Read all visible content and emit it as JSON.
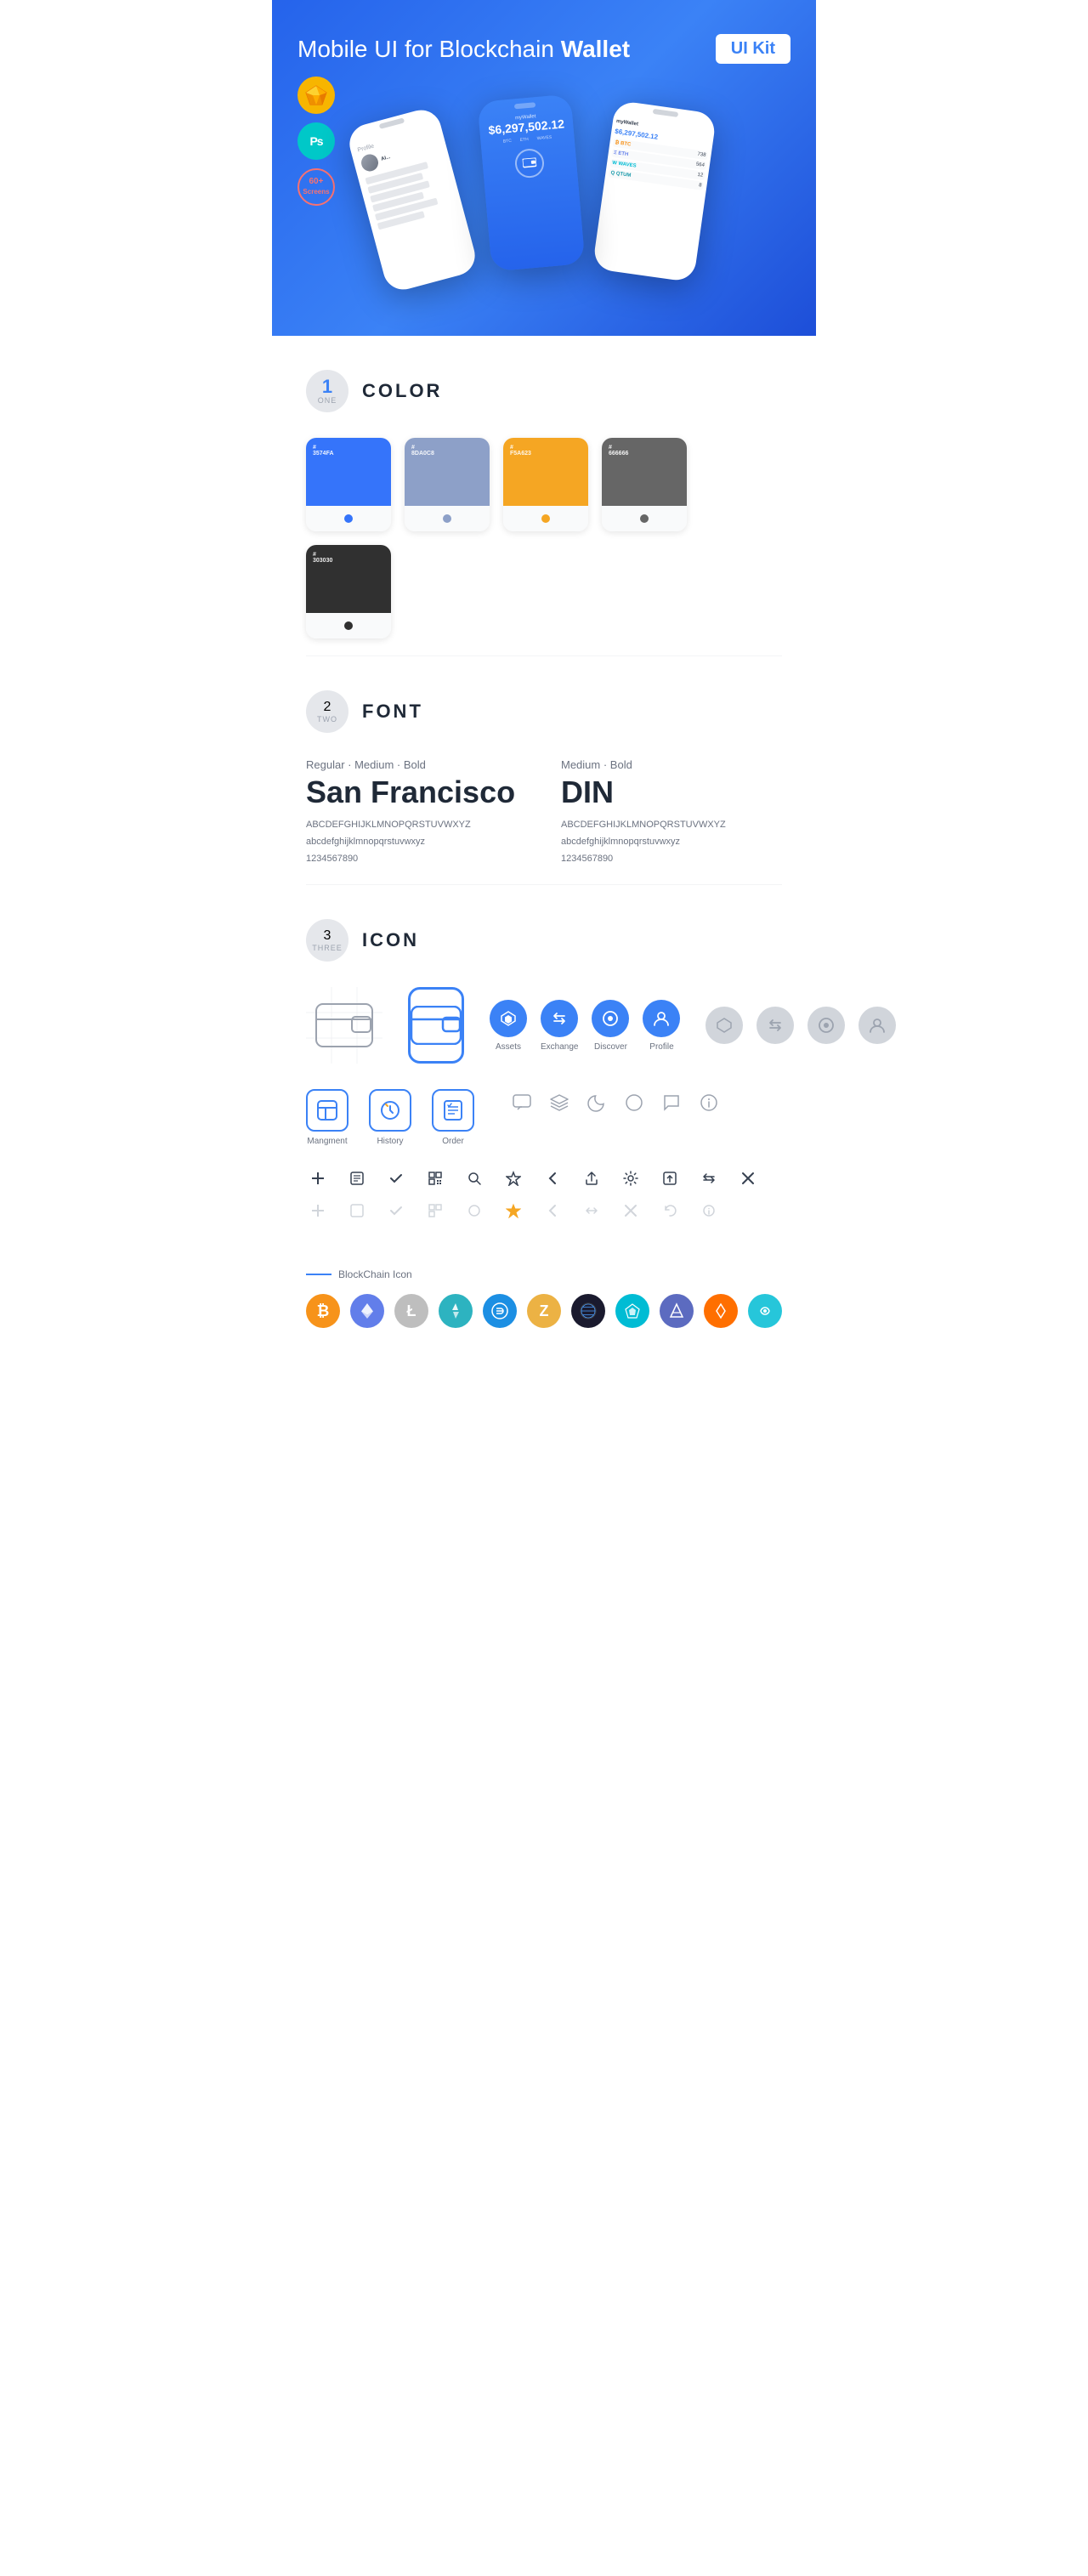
{
  "hero": {
    "title_normal": "Mobile UI for Blockchain ",
    "title_bold": "Wallet",
    "badge": "UI Kit"
  },
  "badges": [
    {
      "name": "Sketch",
      "symbol": "✏️"
    },
    {
      "name": "PS",
      "symbol": "Ps"
    },
    {
      "name": "60+\nScreens",
      "line1": "60+",
      "line2": "Screens"
    }
  ],
  "sections": {
    "color": {
      "number": "1",
      "word": "ONE",
      "title": "COLOR",
      "swatches": [
        {
          "hex": "#3574FA",
          "label": "#\n3574FA",
          "dot_color": "#fff"
        },
        {
          "hex": "#8DA0C8",
          "label": "#\n8DA0C8",
          "dot_color": "#fff"
        },
        {
          "hex": "#F5A623",
          "label": "#\nF5A623",
          "dot_color": "#fff"
        },
        {
          "hex": "#666666",
          "label": "#\n666666",
          "dot_color": "#fff"
        },
        {
          "hex": "#303030",
          "label": "#\n303030",
          "dot_color": "#fff"
        }
      ]
    },
    "font": {
      "number": "2",
      "word": "TWO",
      "title": "FONT",
      "fonts": [
        {
          "style_label": "Regular · Medium · Bold",
          "name": "San Francisco",
          "uppercase": "ABCDEFGHIJKLMNOPQRSTUVWXYZ",
          "lowercase": "abcdefghijklmnopqrstuvwxyz",
          "numbers": "1234567890"
        },
        {
          "style_label": "Medium · Bold",
          "name": "DIN",
          "uppercase": "ABCDEFGHIJKLMNOPQRSTUVWXYZ",
          "lowercase": "abcdefghijklmnopqrstuvwxyz",
          "numbers": "1234567890"
        }
      ]
    },
    "icon": {
      "number": "3",
      "word": "THREE",
      "title": "ICON",
      "nav_icons": [
        {
          "label": "Assets",
          "symbol": "◆"
        },
        {
          "label": "Exchange",
          "symbol": "≋"
        },
        {
          "label": "Discover",
          "symbol": "●"
        },
        {
          "label": "Profile",
          "symbol": "◑"
        }
      ],
      "app_icons": [
        {
          "label": "Mangment",
          "symbol": "▤"
        },
        {
          "label": "History",
          "symbol": "⏱"
        },
        {
          "label": "Order",
          "symbol": "≡"
        }
      ],
      "small_icons": [
        "+",
        "⊞",
        "✓",
        "⊠",
        "🔍",
        "☆",
        "‹",
        "‹‹",
        "⚙",
        "⊡",
        "⇌",
        "✕"
      ],
      "small_icons_gray": [
        "+",
        "⊞",
        "✓",
        "⊠",
        "○",
        "☆",
        "‹",
        "↔",
        "✕",
        "↻",
        "ℹ"
      ],
      "blockchain_label": "BlockChain Icon",
      "crypto": [
        {
          "symbol": "₿",
          "color": "#f7931a",
          "name": "Bitcoin"
        },
        {
          "symbol": "Ξ",
          "color": "#627eea",
          "name": "Ethereum"
        },
        {
          "symbol": "Ł",
          "color": "#bfbbbb",
          "name": "Litecoin"
        },
        {
          "symbol": "◆",
          "color": "#1b9aaa",
          "name": "Augur"
        },
        {
          "symbol": "D",
          "color": "#1e88e5",
          "name": "Dash"
        },
        {
          "symbol": "Z",
          "color": "#f4b728",
          "name": "Zcash"
        },
        {
          "symbol": "◈",
          "color": "#1a1a2e",
          "name": "Grid"
        },
        {
          "symbol": "⬡",
          "color": "#00bcd4",
          "name": "Waves"
        },
        {
          "symbol": "◆",
          "color": "#5c6bc0",
          "name": "Aion"
        },
        {
          "symbol": "◊",
          "color": "#ff6f00",
          "name": "Matic"
        },
        {
          "symbol": "~",
          "color": "#26c6da",
          "name": "Swipe"
        }
      ]
    }
  },
  "misc_row_icons": [
    "💬",
    "≡",
    "◑",
    "●",
    "💬",
    "ℹ"
  ],
  "phone_screens": {
    "left_label": "Profile",
    "center_label": "myWallet",
    "right_label": "BTC / ETH"
  }
}
